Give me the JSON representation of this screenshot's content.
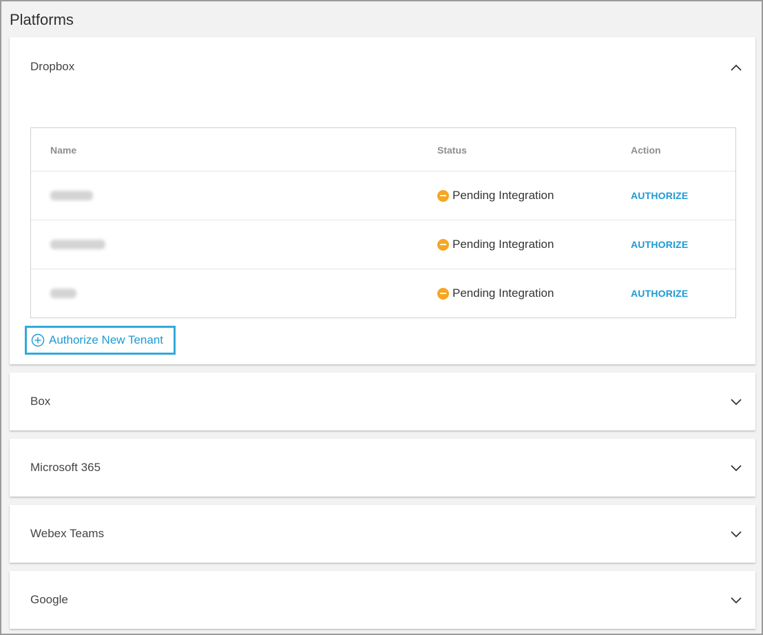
{
  "page": {
    "title": "Platforms"
  },
  "panels": {
    "dropbox": {
      "title": "Dropbox",
      "expanded": true,
      "table": {
        "columns": [
          "Name",
          "Status",
          "Action"
        ],
        "rows": [
          {
            "status": "Pending Integration",
            "action": "AUTHORIZE"
          },
          {
            "status": "Pending Integration",
            "action": "AUTHORIZE"
          },
          {
            "status": "Pending Integration",
            "action": "AUTHORIZE"
          }
        ]
      },
      "add_link": "Authorize New Tenant"
    },
    "box": {
      "title": "Box",
      "expanded": false
    },
    "microsoft": {
      "title": "Microsoft 365",
      "expanded": false
    },
    "webex": {
      "title": "Webex Teams",
      "expanded": false
    },
    "google": {
      "title": "Google",
      "expanded": false
    }
  },
  "icons": {
    "collapse": "chevron-up-icon",
    "expand": "chevron-down-icon",
    "pending": "pending-status-icon",
    "add": "add-circle-icon"
  },
  "colors": {
    "accent": "#1b9ad3",
    "pending": "#f5a623",
    "highlight_border": "#31a9db"
  }
}
